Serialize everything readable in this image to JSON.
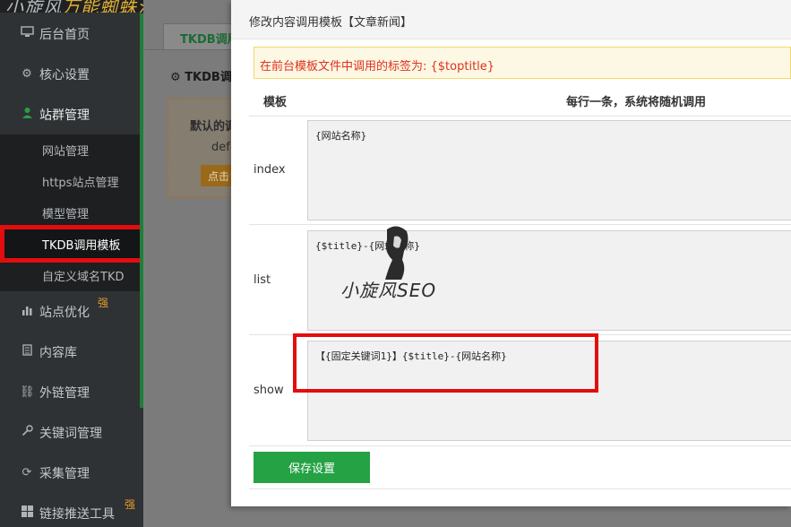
{
  "sidebar": {
    "logo_left": "小旋风",
    "logo_right": "万能蜘蛛池",
    "items": [
      {
        "label": "后台首页",
        "icon": "monitor-icon"
      },
      {
        "label": "核心设置",
        "icon": "gear-icon"
      },
      {
        "label": "站群管理",
        "icon": "user-icon"
      },
      {
        "label": "站点优化",
        "icon": "bar-chart-icon",
        "badge": "强"
      },
      {
        "label": "内容库",
        "icon": "document-icon"
      },
      {
        "label": "外链管理",
        "icon": "link-icon"
      },
      {
        "label": "关键词管理",
        "icon": "key-icon"
      },
      {
        "label": "采集管理",
        "icon": "refresh-icon"
      },
      {
        "label": "链接推送工具",
        "icon": "windows-icon",
        "badge": "强"
      }
    ],
    "submenu": [
      {
        "label": "网站管理"
      },
      {
        "label": "https站点管理"
      },
      {
        "label": "模型管理"
      },
      {
        "label": "TKDB调用模板"
      },
      {
        "label": "自定义域名TKD"
      }
    ]
  },
  "background": {
    "tab": "TKDB调用模板",
    "panel_title": "TKDB调用模板",
    "box_text": "默认的调用模板",
    "box_sub": "default",
    "box_button": "点击"
  },
  "modal": {
    "title": "修改内容调用模板【文章新闻】",
    "notice": "在前台模板文件中调用的标签为: {$toptitle}",
    "col_template": "模板",
    "col_desc": "每行一条，系统将随机调用",
    "rows": [
      {
        "label": "index",
        "value": "{网站名称}"
      },
      {
        "label": "list",
        "value": "{$title}-{网站名称}"
      },
      {
        "label": "show",
        "value": "【{固定关键词1}】{$title}-{网站名称}"
      }
    ],
    "save_label": "保存设置"
  },
  "watermark": {
    "text": "小旋风SEO"
  },
  "colors": {
    "accent": "#25a244",
    "highlight": "#e40d0d",
    "notice_text": "#e0301e",
    "badge": "#e09a2a"
  }
}
